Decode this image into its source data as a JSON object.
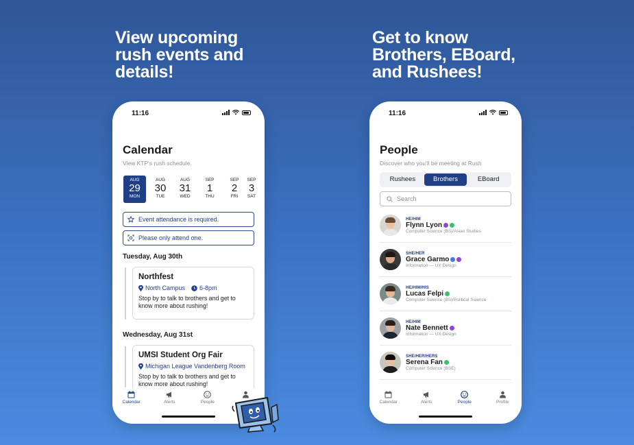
{
  "left_headline": [
    "View upcoming",
    "rush events and",
    "details!"
  ],
  "right_headline": [
    "Get to know",
    "Brothers, EBoard,",
    "and Rushees!"
  ],
  "status_time": "11:16",
  "calendar": {
    "title": "Calendar",
    "subtitle": "View KTP's rush schedule.",
    "dates": [
      {
        "month": "AUG",
        "day": "29",
        "weekday": "MON"
      },
      {
        "month": "AUG",
        "day": "30",
        "weekday": "TUE"
      },
      {
        "month": "AUG",
        "day": "31",
        "weekday": "WED"
      },
      {
        "month": "SEP",
        "day": "1",
        "weekday": "THU"
      },
      {
        "month": "SEP",
        "day": "2",
        "weekday": "FRI"
      },
      {
        "month": "SEP",
        "day": "3",
        "weekday": "SAT"
      }
    ],
    "notices": [
      "Event attendance is required.",
      "Please only attend one."
    ],
    "days": [
      {
        "heading": "Tuesday, Aug 30th",
        "event": {
          "title": "Northfest",
          "location": "North Campus",
          "time": "6-8pm",
          "description": "Stop by to talk to brothers and get to know more about rushing!"
        }
      },
      {
        "heading": "Wednesday, Aug 31st",
        "event": {
          "title": "UMSI Student Org Fair",
          "location": "Michigan League Vandenberg Room",
          "description": "Stop by to talk to brothers and get to know more about rushing!"
        }
      }
    ]
  },
  "people": {
    "title": "People",
    "subtitle": "Discover who you'll be meeting at Rush",
    "segments": [
      "Rushees",
      "Brothers",
      "EBoard"
    ],
    "search_placeholder": "Search",
    "list": [
      {
        "pronouns": "HE/HIM",
        "name": "Flynn Lyon",
        "major": "Computer Science (BS)/Asian Studies"
      },
      {
        "pronouns": "SHE/HER",
        "name": "Grace Garmo",
        "major": "Information — UX Design"
      },
      {
        "pronouns": "HE/HIM/HIS",
        "name": "Lucas Felpi",
        "major": "Computer Science (BS)/Political Science"
      },
      {
        "pronouns": "HE/HIM",
        "name": "Nate Bennett",
        "major": "Information — UX Design"
      },
      {
        "pronouns": "SHE/HER/HERS",
        "name": "Serena Fan",
        "major": "Computer Science (BSE)"
      }
    ]
  },
  "tabs": {
    "calendar": "Calendar",
    "alerts": "Alerts",
    "people": "People",
    "profile": "Profile"
  },
  "colors": {
    "accent": "#213f87",
    "badge_purple": "#8e44d6",
    "badge_green": "#3cbf6a",
    "badge_blue": "#3d7be8"
  }
}
